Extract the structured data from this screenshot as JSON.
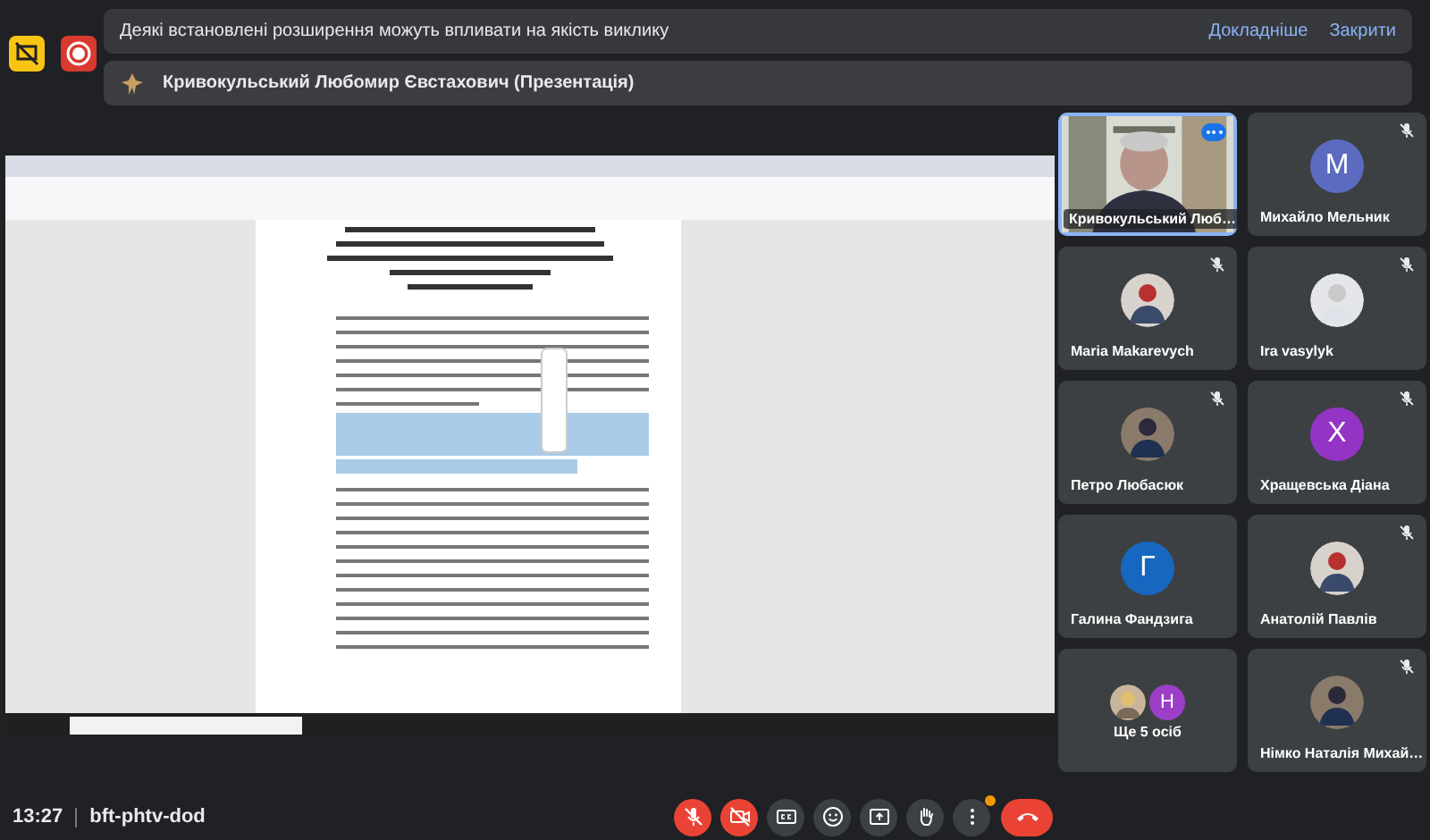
{
  "notices": [
    {
      "kind": "warning",
      "text": "Деякі встановлені розширення можуть впливати на якість виклику",
      "actions": [
        "Докладніше",
        "Закрити"
      ]
    },
    {
      "kind": "presentation",
      "text": "Кривокульський Любомир Євстахович (Презентація)"
    }
  ],
  "participants": [
    {
      "name": "Кривокульський Люб…",
      "kind": "video",
      "muted": false,
      "speaking": true
    },
    {
      "name": "Михайло Мельник",
      "kind": "letter",
      "letter": "М",
      "color": "#5c6bc0",
      "muted": true,
      "speaking": false
    },
    {
      "name": "Maria Makarevych",
      "muted": true,
      "speaking": false
    },
    {
      "name": "Ira vasylyk",
      "muted": true,
      "speaking": false
    },
    {
      "name": "Петро Любасюк",
      "muted": true,
      "speaking": false
    },
    {
      "name": "Хращевська Діана",
      "kind": "letter",
      "letter": "Х",
      "color": "#9334c4",
      "muted": true,
      "speaking": false
    },
    {
      "name": "Галина Фандзига",
      "kind": "letter",
      "letter": "Г",
      "color": "#1767c0",
      "muted": false,
      "speaking": false
    },
    {
      "name": "Анатолій Павлів",
      "muted": true,
      "speaking": false
    },
    {
      "name": "Ще 5 осіб",
      "kind": "others",
      "letter": "Н",
      "color": "#9c3fc6",
      "muted": false,
      "speaking": false
    },
    {
      "name": "Німко Наталія Михай…",
      "muted": true,
      "speaking": false
    }
  ],
  "meeting": {
    "time": "13:27",
    "code": "bft-phtv-dod"
  },
  "controls": [
    {
      "kind": "mic",
      "on": false
    },
    {
      "kind": "camera",
      "on": false
    },
    {
      "kind": "captions",
      "on": false
    },
    {
      "kind": "reactions"
    },
    {
      "kind": "present"
    },
    {
      "kind": "hand",
      "on": false
    },
    {
      "kind": "more",
      "notification": true
    },
    {
      "kind": "leave"
    }
  ]
}
